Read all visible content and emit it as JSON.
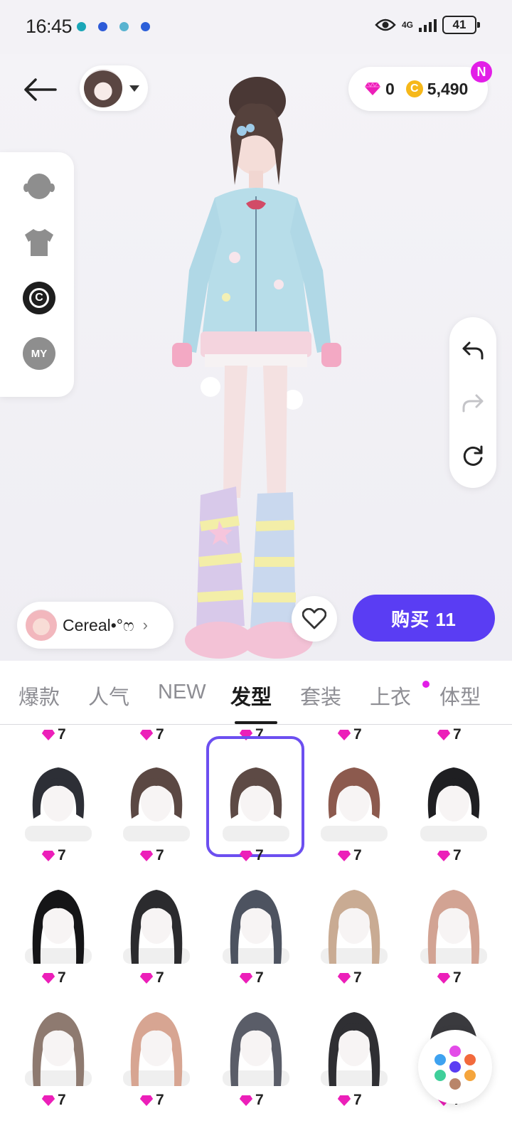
{
  "status_bar": {
    "time": "16:45",
    "network": "4G",
    "battery": "41",
    "notification_dot_colors": [
      "#1aa6b7",
      "#2d5bd8",
      "#58b3d0",
      "#2b5fd9"
    ]
  },
  "header": {
    "currency": {
      "gems": "0",
      "coins": "5,490"
    },
    "badge": "N"
  },
  "left_panel": {
    "my_label": "MY",
    "copyright_glyph": "C"
  },
  "creator": {
    "name": "Cereal•°ෆ"
  },
  "buy_button": {
    "label": "购买 11"
  },
  "tabs": [
    {
      "label": "爆款"
    },
    {
      "label": "人气"
    },
    {
      "label": "NEW"
    },
    {
      "label": "发型"
    },
    {
      "label": "套装"
    },
    {
      "label": "上衣"
    },
    {
      "label": "体型"
    }
  ],
  "grid": {
    "top_row_prices": [
      "7",
      "7",
      "7",
      "7",
      "7"
    ],
    "rows": [
      {
        "items": [
          {
            "name": "black bob with cat ears",
            "price": "7"
          },
          {
            "name": "brown high bun",
            "price": "7"
          },
          {
            "name": "brown messy bun",
            "price": "7",
            "selected": true
          },
          {
            "name": "brown half-up with white bow",
            "price": "7"
          },
          {
            "name": "black low ponytail",
            "price": "7"
          }
        ]
      },
      {
        "items": [
          {
            "name": "black short shag",
            "price": "7"
          },
          {
            "name": "black twin tails",
            "price": "7"
          },
          {
            "name": "grey twin tails with bows",
            "price": "7"
          },
          {
            "name": "light brown long waves",
            "price": "7"
          },
          {
            "name": "pink-brown long with clip",
            "price": "7"
          }
        ]
      },
      {
        "items": [
          {
            "name": "ash brown long waves",
            "price": "7"
          },
          {
            "name": "peach pigtails with flower",
            "price": "7"
          },
          {
            "name": "grey pigtails with bat bows",
            "price": "7"
          },
          {
            "name": "black long waves",
            "price": "7"
          },
          {
            "name": "black layered long",
            "price": "7"
          }
        ]
      }
    ]
  },
  "colors": {
    "accent": "#5a3df3",
    "selected_border": "#6c4ff0",
    "badge": "#e21ee7",
    "gem": "#ec1fb9",
    "coin": "#f6b81a"
  }
}
